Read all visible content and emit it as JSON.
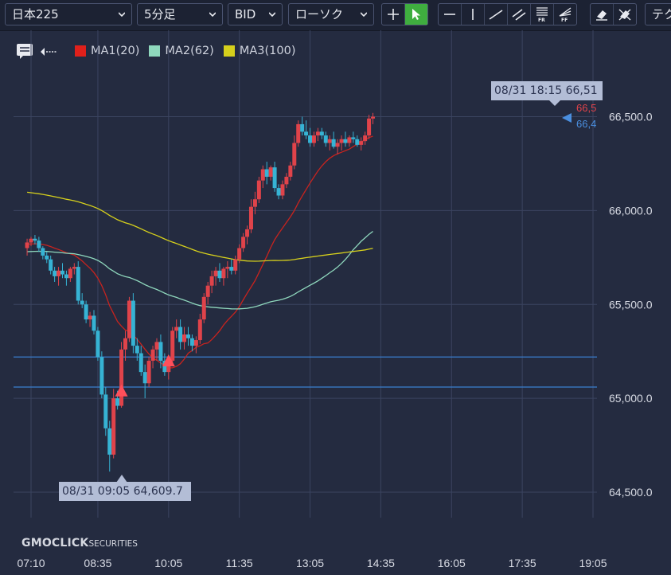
{
  "toolbar": {
    "symbol": "日本225",
    "timeframe": "5分足",
    "price_type": "BID",
    "chart_style": "ローソク",
    "technical_label": "テク",
    "draw_tools": [
      "crosshair-icon",
      "pointer-icon",
      "horizontal-line-icon",
      "vertical-line-icon",
      "trend-line-icon",
      "parallel-lines-icon",
      "fibonacci-retracement-icon",
      "fibonacci-fan-icon"
    ],
    "erase_tools": [
      "eraser-icon",
      "erase-all-icon"
    ]
  },
  "legend": {
    "items": [
      {
        "label": "MA1(20)",
        "color": "#e0201b"
      },
      {
        "label": "MA2(62)",
        "color": "#8fd8bd"
      },
      {
        "label": "MA3(100)",
        "color": "#d6d01c"
      }
    ]
  },
  "callouts": {
    "high": "08/31 18:15 66,51",
    "low": "08/31 09:05 64,609.7"
  },
  "logo": {
    "brand": "GMOCLICK",
    "suffix": "SECURITIES"
  },
  "colors": {
    "up": "#e0434a",
    "down": "#36b3d4",
    "ma1": "#c8231e",
    "ma2": "#8fd8bd",
    "ma3": "#d6d01c",
    "level_line": "#3a7fd0",
    "grid": "#3b4460"
  },
  "chart_data": {
    "type": "candlestick",
    "y_ticks": [
      "66,500.0",
      "66,000.0",
      "65,500.0",
      "65,000.0",
      "64,500.0"
    ],
    "ylim": [
      64350,
      66750
    ],
    "x_ticks": [
      "07:10",
      "08:35",
      "10:05",
      "11:35",
      "13:05",
      "14:35",
      "16:05",
      "17:35",
      "19:05"
    ],
    "x_tick_minutes": [
      430,
      515,
      605,
      695,
      785,
      875,
      965,
      1055,
      1145
    ],
    "xlim": [
      420,
      1160
    ],
    "horizontal_levels": [
      65220,
      65060
    ],
    "last_price_tags": {
      "top": "66,5",
      "bottom": "66,4"
    },
    "markers": [
      {
        "type": "buy",
        "time": "09:05",
        "price": 65040
      },
      {
        "type": "buy",
        "time": "10:05",
        "price": 65200
      }
    ],
    "ohlc_5min_from_07_05": [
      [
        65800,
        65850,
        65760,
        65830
      ],
      [
        65830,
        65860,
        65810,
        65850
      ],
      [
        65850,
        65870,
        65820,
        65840
      ],
      [
        65840,
        65860,
        65780,
        65800
      ],
      [
        65800,
        65810,
        65740,
        65760
      ],
      [
        65760,
        65780,
        65720,
        65740
      ],
      [
        65740,
        65760,
        65660,
        65680
      ],
      [
        65680,
        65700,
        65620,
        65650
      ],
      [
        65650,
        65700,
        65600,
        65680
      ],
      [
        65680,
        65720,
        65640,
        65660
      ],
      [
        65660,
        65680,
        65600,
        65640
      ],
      [
        65640,
        65700,
        65620,
        65690
      ],
      [
        65690,
        65720,
        65660,
        65700
      ],
      [
        65700,
        65730,
        65500,
        65520
      ],
      [
        65520,
        65560,
        65480,
        65500
      ],
      [
        65500,
        65520,
        65400,
        65420
      ],
      [
        65420,
        65460,
        65380,
        65440
      ],
      [
        65440,
        65470,
        65340,
        65360
      ],
      [
        65360,
        65380,
        65200,
        65220
      ],
      [
        65220,
        65250,
        65000,
        65020
      ],
      [
        65020,
        65060,
        64800,
        64840
      ],
      [
        64840,
        64880,
        64609.7,
        64700
      ],
      [
        64700,
        65050,
        64680,
        65000
      ],
      [
        65000,
        65040,
        64940,
        64960
      ],
      [
        64960,
        65300,
        64950,
        65260
      ],
      [
        65260,
        65360,
        65200,
        65320
      ],
      [
        65320,
        65540,
        65300,
        65520
      ],
      [
        65520,
        65560,
        65240,
        65280
      ],
      [
        65280,
        65320,
        65200,
        65240
      ],
      [
        65240,
        65280,
        65120,
        65140
      ],
      [
        65140,
        65180,
        65000,
        65080
      ],
      [
        65080,
        65220,
        65060,
        65200
      ],
      [
        65200,
        65280,
        65160,
        65260
      ],
      [
        65260,
        65320,
        65200,
        65300
      ],
      [
        65300,
        65340,
        65160,
        65200
      ],
      [
        65200,
        65240,
        65120,
        65140
      ],
      [
        65140,
        65220,
        65100,
        65200
      ],
      [
        65200,
        65380,
        65180,
        65360
      ],
      [
        65360,
        65420,
        65320,
        65380
      ],
      [
        65380,
        65420,
        65260,
        65300
      ],
      [
        65300,
        65380,
        65260,
        65340
      ],
      [
        65340,
        65380,
        65280,
        65320
      ],
      [
        65320,
        65340,
        65250,
        65280
      ],
      [
        65280,
        65330,
        65240,
        65310
      ],
      [
        65310,
        65450,
        65290,
        65420
      ],
      [
        65420,
        65560,
        65400,
        65540
      ],
      [
        65540,
        65620,
        65500,
        65600
      ],
      [
        65600,
        65680,
        65560,
        65650
      ],
      [
        65650,
        65700,
        65600,
        65680
      ],
      [
        65680,
        65720,
        65620,
        65640
      ],
      [
        65640,
        65700,
        65600,
        65690
      ],
      [
        65690,
        65730,
        65640,
        65700
      ],
      [
        65700,
        65740,
        65660,
        65680
      ],
      [
        65680,
        65760,
        65660,
        65740
      ],
      [
        65740,
        65820,
        65720,
        65800
      ],
      [
        65800,
        65880,
        65780,
        65860
      ],
      [
        65860,
        65920,
        65820,
        65900
      ],
      [
        65900,
        66060,
        65880,
        66020
      ],
      [
        66020,
        66100,
        65980,
        66060
      ],
      [
        66060,
        66180,
        66040,
        66160
      ],
      [
        66160,
        66240,
        66120,
        66220
      ],
      [
        66220,
        66260,
        66140,
        66180
      ],
      [
        66180,
        66240,
        66160,
        66230
      ],
      [
        66230,
        66260,
        66100,
        66120
      ],
      [
        66120,
        66140,
        66060,
        66080
      ],
      [
        66080,
        66160,
        66060,
        66140
      ],
      [
        66140,
        66200,
        66120,
        66180
      ],
      [
        66180,
        66260,
        66160,
        66240
      ],
      [
        66240,
        66400,
        66220,
        66360
      ],
      [
        66360,
        66480,
        66340,
        66460
      ],
      [
        66460,
        66500,
        66400,
        66420
      ],
      [
        66420,
        66480,
        66380,
        66400
      ],
      [
        66400,
        66440,
        66340,
        66360
      ],
      [
        66360,
        66420,
        66340,
        66400
      ],
      [
        66400,
        66440,
        66370,
        66420
      ],
      [
        66420,
        66440,
        66380,
        66400
      ],
      [
        66400,
        66420,
        66340,
        66360
      ],
      [
        66360,
        66400,
        66320,
        66380
      ],
      [
        66380,
        66420,
        66330,
        66340
      ],
      [
        66340,
        66380,
        66300,
        66360
      ],
      [
        66360,
        66400,
        66320,
        66380
      ],
      [
        66380,
        66420,
        66340,
        66360
      ],
      [
        66360,
        66400,
        66340,
        66390
      ],
      [
        66390,
        66420,
        66360,
        66380
      ],
      [
        66380,
        66400,
        66340,
        66350
      ],
      [
        66350,
        66390,
        66320,
        66370
      ],
      [
        66370,
        66420,
        66350,
        66400
      ],
      [
        66400,
        66510,
        66380,
        66490
      ],
      [
        66490,
        66520,
        66460,
        66500
      ]
    ]
  }
}
